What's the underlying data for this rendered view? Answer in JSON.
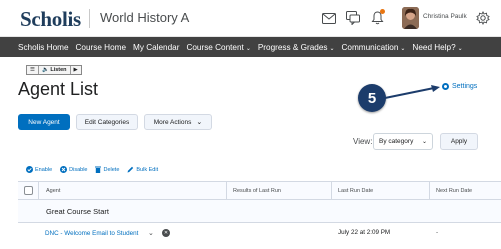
{
  "header": {
    "logo": "Scholis",
    "course_title": "World History A",
    "user_name": "Christina Paulk"
  },
  "nav": {
    "items": [
      {
        "label": "Scholis Home",
        "dropdown": false
      },
      {
        "label": "Course Home",
        "dropdown": false
      },
      {
        "label": "My Calendar",
        "dropdown": false
      },
      {
        "label": "Course Content",
        "dropdown": true
      },
      {
        "label": "Progress & Grades",
        "dropdown": true
      },
      {
        "label": "Communication",
        "dropdown": true
      },
      {
        "label": "Need Help?",
        "dropdown": true
      }
    ]
  },
  "listen": {
    "label": "Listen"
  },
  "page": {
    "title": "Agent List"
  },
  "annotation": {
    "step": "5"
  },
  "settings": {
    "label": "Settings"
  },
  "buttons": {
    "new_agent": "New Agent",
    "edit_categories": "Edit Categories",
    "more_actions": "More Actions"
  },
  "view": {
    "label": "View:",
    "selected": "By category",
    "apply": "Apply"
  },
  "actions": [
    {
      "label": "Enable",
      "icon": "check-circle-icon"
    },
    {
      "label": "Disable",
      "icon": "disable-circle-icon"
    },
    {
      "label": "Delete",
      "icon": "trash-icon"
    },
    {
      "label": "Bulk Edit",
      "icon": "pencil-icon"
    }
  ],
  "table": {
    "columns": [
      "Agent",
      "Results of Last Run",
      "Last Run Date",
      "Next Run Date"
    ],
    "group": "Great Course Start",
    "rows": [
      {
        "agent": "DNC - Welcome Email to Student",
        "last_run": "July 22 at 2:09 PM",
        "next_run": "-"
      }
    ]
  },
  "colors": {
    "primary": "#006fbf",
    "navbar": "#414141",
    "badge": "#1c3c6b",
    "notification": "#e87511"
  }
}
